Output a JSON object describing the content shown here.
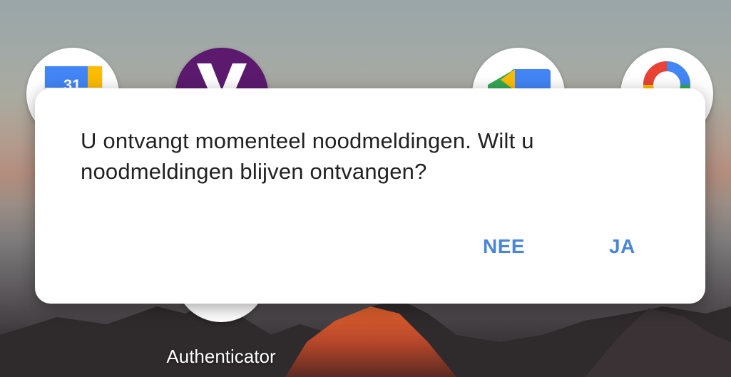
{
  "status_bar": {
    "fragments": [
      "",
      "",
      "",
      ""
    ]
  },
  "home": {
    "apps": [
      {
        "name": "Calendar",
        "icon": "calendar-icon"
      },
      {
        "name": "Yahoo",
        "icon": "yahoo-icon"
      },
      {
        "name": "Files",
        "icon": "files-icon"
      },
      {
        "name": "Google One",
        "icon": "google-one-icon"
      },
      {
        "name": "Authenticator",
        "icon": "authenticator-icon"
      }
    ],
    "visible_label": "Authenticator"
  },
  "dialog": {
    "message": "U ontvangt momenteel noodmeldingen. Wilt u noodmeldingen blijven ontvangen?",
    "negative_label": "NEE",
    "positive_label": "JA"
  },
  "colors": {
    "button_text": "#4a86d8",
    "message_text": "#212121",
    "dialog_bg": "#ffffff"
  }
}
